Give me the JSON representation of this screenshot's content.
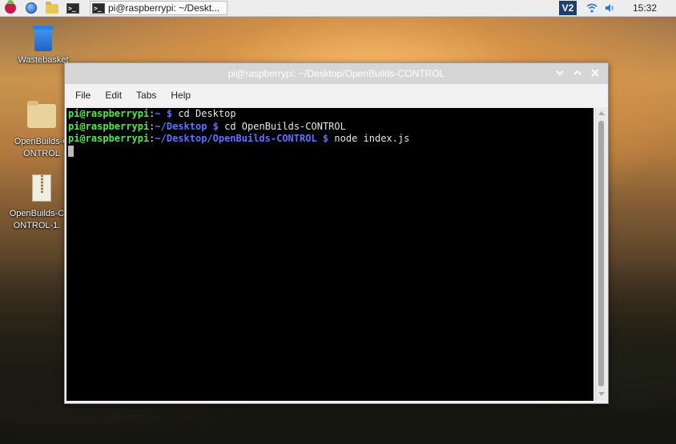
{
  "panel": {
    "task_title": "pi@raspberrypi: ~/Deskt...",
    "vnc_label": "V2",
    "clock": "15:32"
  },
  "desktop": {
    "icons": [
      {
        "label": "Wastebasket",
        "icon": "trash-icon"
      },
      {
        "label": "OpenBuilds-CONTROL",
        "icon": "folder-icon"
      },
      {
        "label": "OpenBuilds-CONTROL-1.",
        "icon": "zip-archive-icon"
      }
    ]
  },
  "window": {
    "title": "pi@raspberrypi: ~/Desktop/OpenBuilds-CONTROL",
    "menu": [
      "File",
      "Edit",
      "Tabs",
      "Help"
    ]
  },
  "terminal": {
    "lines": [
      {
        "user": "pi@raspberrypi",
        "colon": ":",
        "path": "~",
        "sigil": "$",
        "command": "cd Desktop"
      },
      {
        "user": "pi@raspberrypi",
        "colon": ":",
        "path": "~/Desktop",
        "sigil": "$",
        "command": "cd OpenBuilds-CONTROL"
      },
      {
        "user": "pi@raspberrypi",
        "colon": ":",
        "path": "~/Desktop/OpenBuilds-CONTROL",
        "sigil": "$",
        "command": "node index.js"
      }
    ]
  },
  "colors": {
    "prompt_user": "#55e84e",
    "prompt_path": "#5c73ff",
    "terminal_bg": "#000000"
  }
}
